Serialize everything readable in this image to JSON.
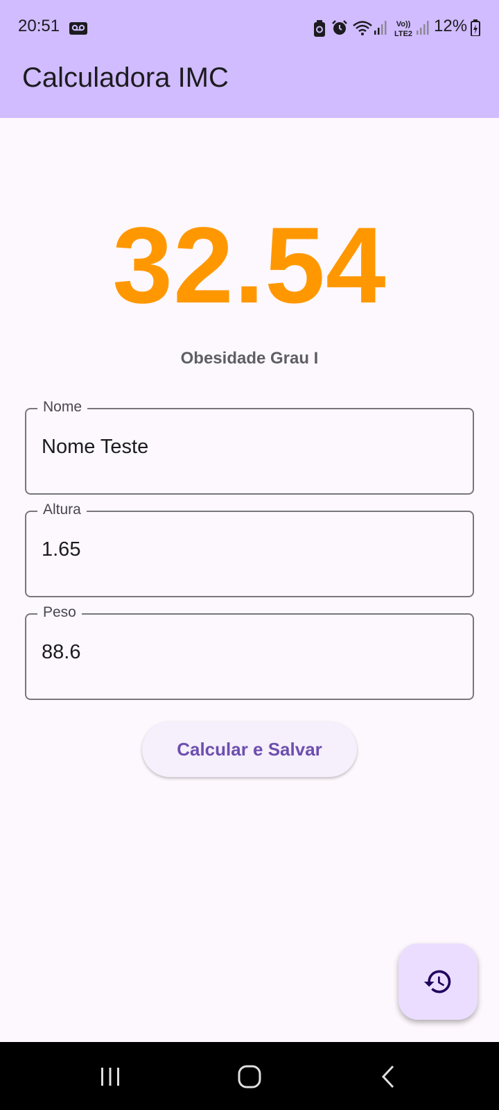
{
  "status_bar": {
    "time": "20:51",
    "battery": "12%",
    "icons": [
      "voicemail-icon",
      "battery-saver-icon",
      "alarm-icon",
      "wifi-icon",
      "signal-icon",
      "volte-icon",
      "signal-icon",
      "battery-icon"
    ],
    "volte_line1": "Vo))",
    "volte_line2": "LTE2"
  },
  "app_bar": {
    "title": "Calculadora IMC"
  },
  "result": {
    "bmi": "32.54",
    "category": "Obesidade Grau I",
    "bmi_color": "#ff9800"
  },
  "form": {
    "name_label": "Nome",
    "name_value": "Nome Teste",
    "height_label": "Altura",
    "height_value": "1.65",
    "weight_label": "Peso",
    "weight_value": "88.6"
  },
  "actions": {
    "calculate_label": "Calcular e Salvar",
    "history_icon": "history-icon"
  },
  "nav_bar": {
    "icons": [
      "recent-apps-icon",
      "home-icon",
      "back-icon"
    ]
  },
  "colors": {
    "app_bar": "#d0bcff",
    "background": "#fdf8fd",
    "button_text": "#6c4fae",
    "fab": "#eaddff"
  }
}
